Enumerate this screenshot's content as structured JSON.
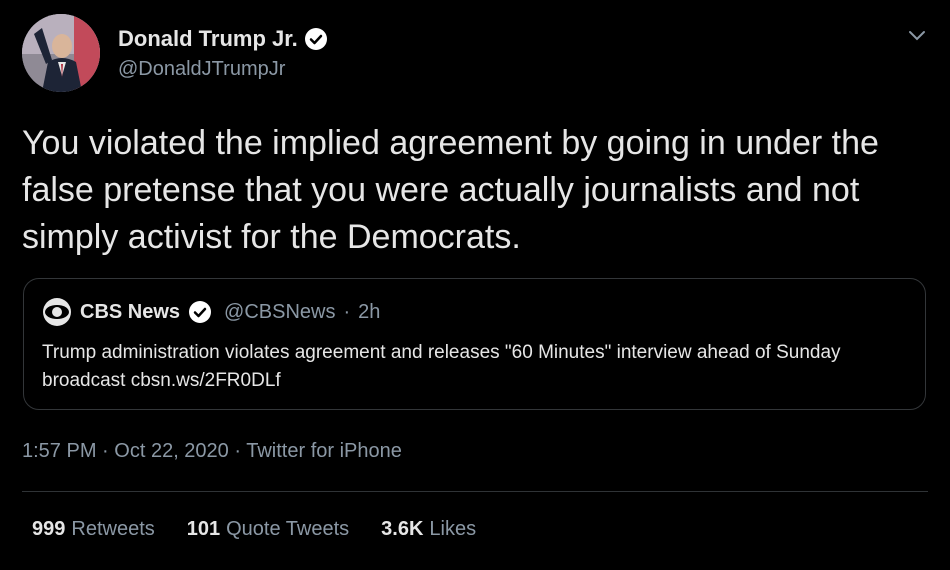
{
  "author": {
    "name": "Donald Trump Jr.",
    "handle": "@DonaldJTrumpJr",
    "verified_icon": "verified-badge-icon"
  },
  "tweet": {
    "text": "You violated the implied agreement by going in under the false pretense that you were actually journalists and not simply activist for the Democrats."
  },
  "quoted": {
    "name": "CBS News",
    "handle": "@CBSNews",
    "separator": "·",
    "age": "2h",
    "text": "Trump administration violates agreement and releases \"60 Minutes\" interview ahead of Sunday broadcast cbsn.ws/2FR0DLf",
    "logo_icon": "cbs-eye-logo-icon"
  },
  "meta": {
    "time": "1:57 PM",
    "separator": "·",
    "date": "Oct 22, 2020",
    "source": "Twitter for iPhone"
  },
  "stats": {
    "retweets_count": "999",
    "retweets_label": "Retweets",
    "quotes_count": "101",
    "quotes_label": "Quote Tweets",
    "likes_count": "3.6K",
    "likes_label": "Likes"
  },
  "colors": {
    "background": "#000000",
    "text": "#e6e6e6",
    "secondary": "#8b98a5",
    "border": "#333639"
  }
}
